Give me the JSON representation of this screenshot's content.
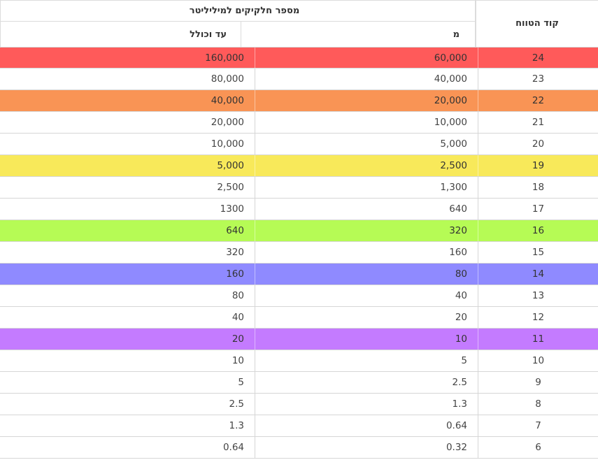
{
  "header": {
    "group_title": "מספר חלקיקים למיליליטר",
    "to_label": "עד וכולל",
    "from_label": "מ",
    "code_label": "קוד הטווח"
  },
  "rows": [
    {
      "code": "24",
      "from": "60,000",
      "to": "160,000",
      "color": "#ff5a5a"
    },
    {
      "code": "23",
      "from": "40,000",
      "to": "80,000",
      "color": ""
    },
    {
      "code": "22",
      "from": "20,000",
      "to": "40,000",
      "color": "#f99455"
    },
    {
      "code": "21",
      "from": "10,000",
      "to": "20,000",
      "color": ""
    },
    {
      "code": "20",
      "from": "5,000",
      "to": "10,000",
      "color": ""
    },
    {
      "code": "19",
      "from": "2,500",
      "to": "5,000",
      "color": "#f8e95a"
    },
    {
      "code": "18",
      "from": "1,300",
      "to": "2,500",
      "color": ""
    },
    {
      "code": "17",
      "from": "640",
      "to": "1300",
      "color": ""
    },
    {
      "code": "16",
      "from": "320",
      "to": "640",
      "color": "#b6fb55"
    },
    {
      "code": "15",
      "from": "160",
      "to": "320",
      "color": ""
    },
    {
      "code": "14",
      "from": "80",
      "to": "160",
      "color": "#8f8aff"
    },
    {
      "code": "13",
      "from": "40",
      "to": "80",
      "color": ""
    },
    {
      "code": "12",
      "from": "20",
      "to": "40",
      "color": ""
    },
    {
      "code": "11",
      "from": "10",
      "to": "20",
      "color": "#c47bff"
    },
    {
      "code": "10",
      "from": "5",
      "to": "10",
      "color": ""
    },
    {
      "code": "9",
      "from": "2.5",
      "to": "5",
      "color": ""
    },
    {
      "code": "8",
      "from": "1.3",
      "to": "2.5",
      "color": ""
    },
    {
      "code": "7",
      "from": "0.64",
      "to": "1.3",
      "color": ""
    },
    {
      "code": "6",
      "from": "0.32",
      "to": "0.64",
      "color": ""
    }
  ]
}
